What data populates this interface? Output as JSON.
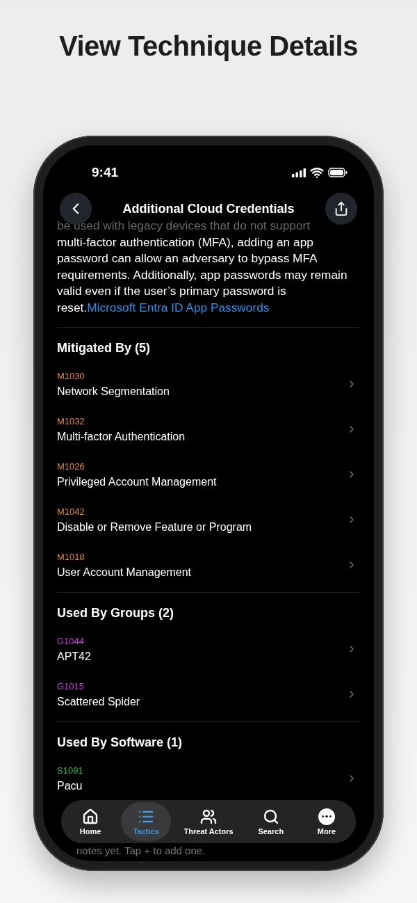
{
  "page_title": "View Technique Details",
  "status_bar": {
    "time": "9:41"
  },
  "header": {
    "title": "Additional Cloud Credentials"
  },
  "description": {
    "faded_line": "be used with legacy devices that do not support",
    "text": "multi-factor authentication (MFA), adding an app password can allow an adversary to bypass MFA requirements. Additionally, app passwords may remain valid even if the user’s primary password is reset.",
    "link": "Microsoft Entra ID App Passwords"
  },
  "sections": [
    {
      "title": "Mitigated By (5)",
      "color": "#e08a3c",
      "items": [
        {
          "id": "M1030",
          "name": "Network Segmentation"
        },
        {
          "id": "M1032",
          "name": "Multi-factor Authentication"
        },
        {
          "id": "M1026",
          "name": "Privileged Account Management"
        },
        {
          "id": "M1042",
          "name": "Disable or Remove Feature or Program"
        },
        {
          "id": "M1018",
          "name": "User Account Management"
        }
      ]
    },
    {
      "title": "Used By Groups (2)",
      "color": "#c43fd8",
      "items": [
        {
          "id": "G1044",
          "name": "APT42"
        },
        {
          "id": "G1015",
          "name": "Scattered Spider"
        }
      ]
    },
    {
      "title": "Used By Software (1)",
      "color": "#3dba5a",
      "items": [
        {
          "id": "S1091",
          "name": "Pacu"
        }
      ]
    }
  ],
  "notes": {
    "text": "notes yet. Tap + to add one."
  },
  "tab_bar": [
    {
      "label": "Home",
      "kind": "home",
      "selected": false
    },
    {
      "label": "Tactics",
      "kind": "list",
      "selected": true
    },
    {
      "label": "Threat Actors",
      "kind": "people",
      "selected": false
    },
    {
      "label": "Search",
      "kind": "search",
      "selected": false
    },
    {
      "label": "More",
      "kind": "more",
      "selected": false
    }
  ]
}
